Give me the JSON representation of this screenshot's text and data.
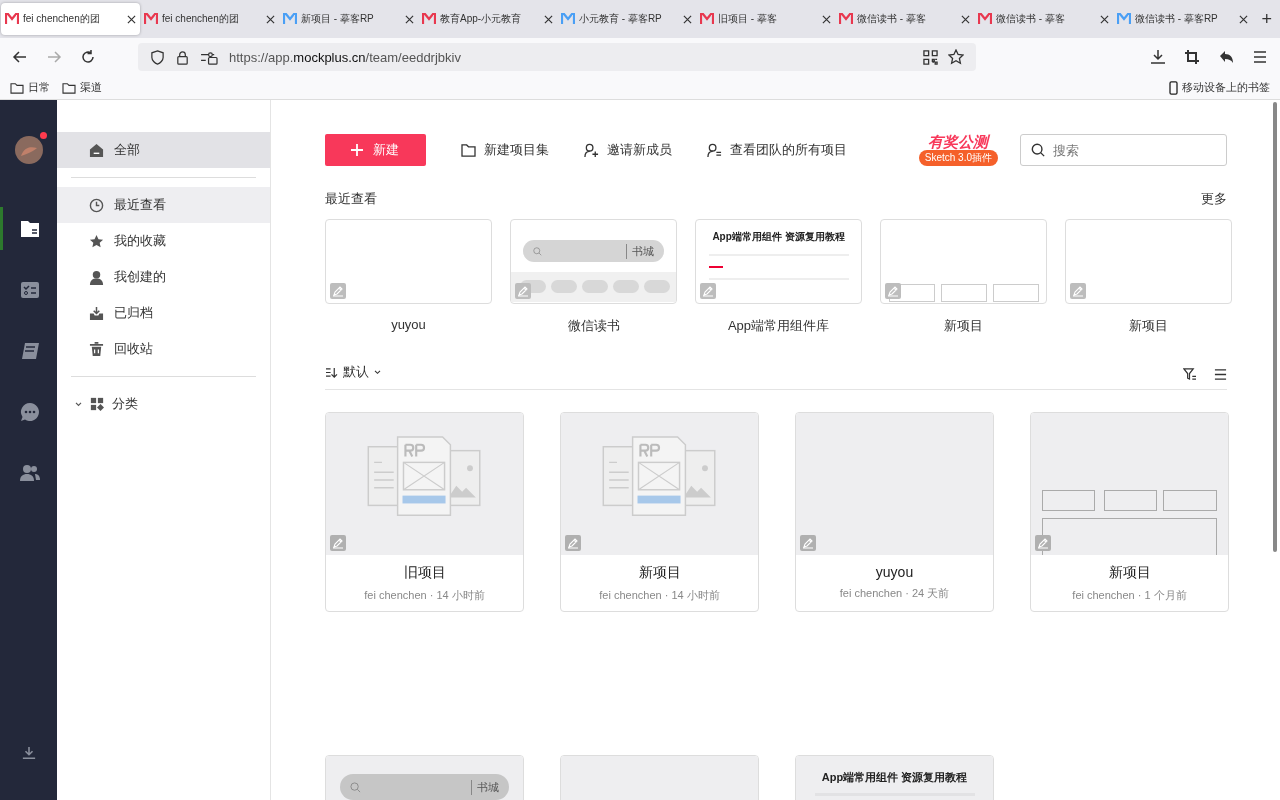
{
  "browser": {
    "tabs": [
      {
        "title": "fei chenchen的团",
        "color": "#e8384f",
        "selected": true
      },
      {
        "title": "fei chenchen的团",
        "color": "#e8384f",
        "selected": false
      },
      {
        "title": "新项目 - 摹客RP",
        "color": "#4a9ff5",
        "selected": false
      },
      {
        "title": "教育App-小元教育",
        "color": "#e8384f",
        "selected": false
      },
      {
        "title": "小元教育 - 摹客RP",
        "color": "#4a9ff5",
        "selected": false
      },
      {
        "title": "旧项目 - 摹客",
        "color": "#e8384f",
        "selected": false
      },
      {
        "title": "微信读书 - 摹客",
        "color": "#e8384f",
        "selected": false
      },
      {
        "title": "微信读书 - 摹客",
        "color": "#e8384f",
        "selected": false
      },
      {
        "title": "微信读书 - 摹客RP",
        "color": "#4a9ff5",
        "selected": false
      }
    ],
    "new_tab": "+",
    "url": {
      "start": "https://app.",
      "domain": "mockplus.cn",
      "path": "/team/eeddrjbkiv"
    },
    "bookmarks": [
      "日常",
      "渠道"
    ],
    "mobile_bookmarks": "移动设备上的书签"
  },
  "rail": {
    "avatar": {
      "notification": true
    },
    "items": [
      {
        "kind": "folder",
        "selected": true
      },
      {
        "kind": "tasks",
        "selected": false
      },
      {
        "kind": "book",
        "selected": false
      },
      {
        "kind": "chat",
        "selected": false
      },
      {
        "kind": "team",
        "selected": false
      }
    ]
  },
  "sidebar": {
    "top": {
      "kind": "home",
      "label": "全部",
      "selected": true
    },
    "items": [
      {
        "kind": "clock",
        "label": "最近查看",
        "selected": false,
        "hovered": true
      },
      {
        "kind": "star",
        "label": "我的收藏",
        "selected": false,
        "hovered": false
      },
      {
        "kind": "user",
        "label": "我创建的",
        "selected": false,
        "hovered": false
      },
      {
        "kind": "archive",
        "label": "已归档",
        "selected": false,
        "hovered": false
      },
      {
        "kind": "trash",
        "label": "回收站",
        "selected": false,
        "hovered": false
      }
    ],
    "category": {
      "label": "分类",
      "expanded": true
    }
  },
  "toolbar": {
    "new_button": "新建",
    "actions": [
      {
        "kind": "folder",
        "label": "新建项目集"
      },
      {
        "kind": "add-user",
        "label": "邀请新成员"
      },
      {
        "kind": "user-list",
        "label": "查看团队的所有项目"
      }
    ],
    "promo": {
      "title": "有奖公测",
      "subtitle": "Sketch 3.0插件"
    },
    "search": {
      "placeholder": "搜索"
    }
  },
  "recent": {
    "title": "最近查看",
    "more": "更多",
    "items": [
      {
        "name": "yuyou",
        "thumb": {
          "kind": "blank"
        }
      },
      {
        "name": "微信读书",
        "thumb": {
          "kind": "search",
          "label": "书城"
        }
      },
      {
        "name": "App端常用组件库",
        "thumb": {
          "kind": "doc",
          "title": "App端常用组件 资源复用教程"
        }
      },
      {
        "name": "新项目",
        "thumb": {
          "kind": "boxes"
        }
      },
      {
        "name": "新项目",
        "thumb": {
          "kind": "blank"
        }
      }
    ]
  },
  "sort": {
    "label": "默认"
  },
  "projects": [
    {
      "name": "旧项目",
      "meta": "fei chenchen · 14 小时前",
      "thumb": {
        "kind": "rp"
      }
    },
    {
      "name": "新项目",
      "meta": "fei chenchen · 14 小时前",
      "thumb": {
        "kind": "rp"
      }
    },
    {
      "name": "yuyou",
      "meta": "fei chenchen · 24 天前",
      "thumb": {
        "kind": "blank"
      }
    },
    {
      "name": "新项目",
      "meta": "fei chenchen · 1 个月前",
      "thumb": {
        "kind": "boxes"
      }
    },
    {
      "thumb": {
        "kind": "search",
        "label": "书城"
      }
    },
    {
      "thumb": {
        "kind": "blank"
      }
    },
    {
      "thumb": {
        "kind": "doc",
        "title": "App端常用组件 资源复用教程"
      }
    }
  ]
}
